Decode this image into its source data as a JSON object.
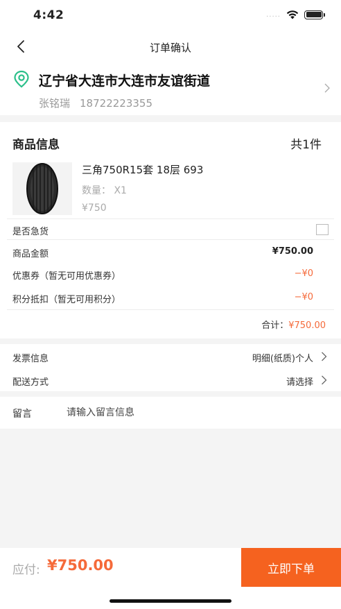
{
  "status_bar": {
    "time": "4:42",
    "signal": "....."
  },
  "nav": {
    "title": "订单确认",
    "back_icon": "chevron-left-icon"
  },
  "address": {
    "icon": "location-pin-icon",
    "line": "辽宁省大连市大连市友谊街道",
    "name": "张铭瑞",
    "phone": "18722223355"
  },
  "goods": {
    "header_title": "商品信息",
    "count_label": "共1件",
    "items": [
      {
        "name": "三角750R15套 18层 693",
        "qty_label": "数量：  X1",
        "price": "¥750",
        "image": "tire-image"
      }
    ]
  },
  "summary": {
    "urgent_label": "是否急货",
    "urgent_checked": false,
    "amount_label": "商品金额",
    "amount_value": "¥750.00",
    "coupon_label": "优惠券（暂无可用优惠券）",
    "coupon_value": "−¥0",
    "points_label": "积分抵扣（暂无可用积分）",
    "points_value": "−¥0",
    "total_label": "合计：",
    "total_value": "¥750.00"
  },
  "invoice": {
    "label": "发票信息",
    "value": "明细(纸质)个人",
    "delivery_label": "配送方式",
    "delivery_value": "请选择"
  },
  "message": {
    "label": "留言",
    "placeholder": "请输入留言信息"
  },
  "bottom": {
    "pay_label": "应付:",
    "pay_amount": "¥750.00",
    "submit_label": "立即下单"
  },
  "colors": {
    "accent": "#f5621f",
    "price_red": "#f56a3a",
    "icon_green": "#2bbf8a"
  }
}
